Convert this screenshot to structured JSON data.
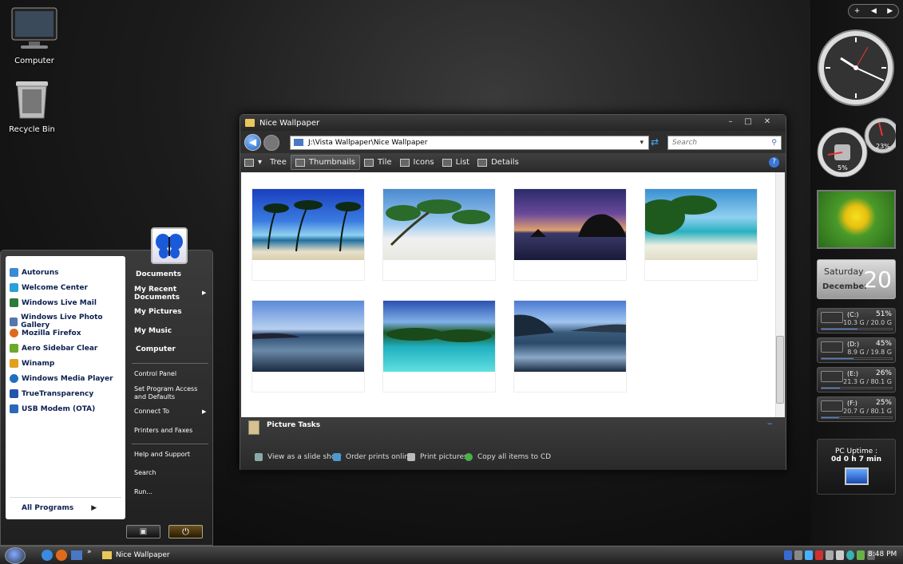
{
  "desktop": {
    "icons": [
      {
        "label": "Computer"
      },
      {
        "label": "Recycle Bin"
      }
    ]
  },
  "window": {
    "title": "Nice Wallpaper",
    "address": "J:\\Vista Wallpaper\\Nice Wallpaper",
    "search_placeholder": "Search",
    "toolbar": [
      "Tree",
      "Thumbnails",
      "Tile",
      "Icons",
      "List",
      "Details"
    ],
    "selected_view": "Thumbnails",
    "task_header": "Picture Tasks",
    "tasks": [
      "View as a slide show",
      "Order prints online",
      "Print pictures",
      "Copy all items to CD"
    ]
  },
  "start_menu": {
    "programs": [
      {
        "label": "Autoruns",
        "color": "#3a8ad4"
      },
      {
        "label": "Welcome Center",
        "color": "#2aa0d8"
      },
      {
        "label": "Windows Live Mail",
        "color": "#2d7a3a"
      },
      {
        "label": "Windows Live Photo Gallery",
        "color": "#5577aa"
      },
      {
        "label": "Mozilla Firefox",
        "color": "#e06a1c"
      },
      {
        "label": "Aero Sidebar Clear",
        "color": "#6aaa2a"
      },
      {
        "label": "Winamp",
        "color": "#e0a020"
      },
      {
        "label": "Windows Media Player",
        "color": "#1e6fc4"
      },
      {
        "label": "TrueTransparency",
        "color": "#2255aa"
      },
      {
        "label": "USB Modem (OTA)",
        "color": "#2a68b8"
      }
    ],
    "all_programs": "All Programs",
    "places": [
      "Documents",
      "My Recent Documents",
      "My Pictures",
      "My Music",
      "Computer"
    ],
    "system": [
      "Control Panel",
      "Set Program Access and Defaults",
      "Connect To",
      "Printers and Faxes"
    ],
    "help": [
      "Help and Support",
      "Search",
      "Run..."
    ]
  },
  "taskbar": {
    "task_label": "Nice Wallpaper",
    "clock": "8:48 PM"
  },
  "sidebar": {
    "cpu_percent": "5%",
    "mem_percent": "23%",
    "calendar": {
      "day": "Saturday",
      "month": "December",
      "date": "20"
    },
    "drives": [
      {
        "letter": "(C:)",
        "percent": "51%",
        "space": "10.3 G / 20.0 G",
        "used": 0.51
      },
      {
        "letter": "(D:)",
        "percent": "45%",
        "space": "8.9 G / 19.8 G",
        "used": 0.45
      },
      {
        "letter": "(E:)",
        "percent": "26%",
        "space": "21.3 G / 80.1 G",
        "used": 0.26
      },
      {
        "letter": "(F:)",
        "percent": "25%",
        "space": "20.7 G / 80.1 G",
        "used": 0.25
      }
    ],
    "uptime_label": "PC Uptime :",
    "uptime_value": "0d 0 h 7 min"
  }
}
